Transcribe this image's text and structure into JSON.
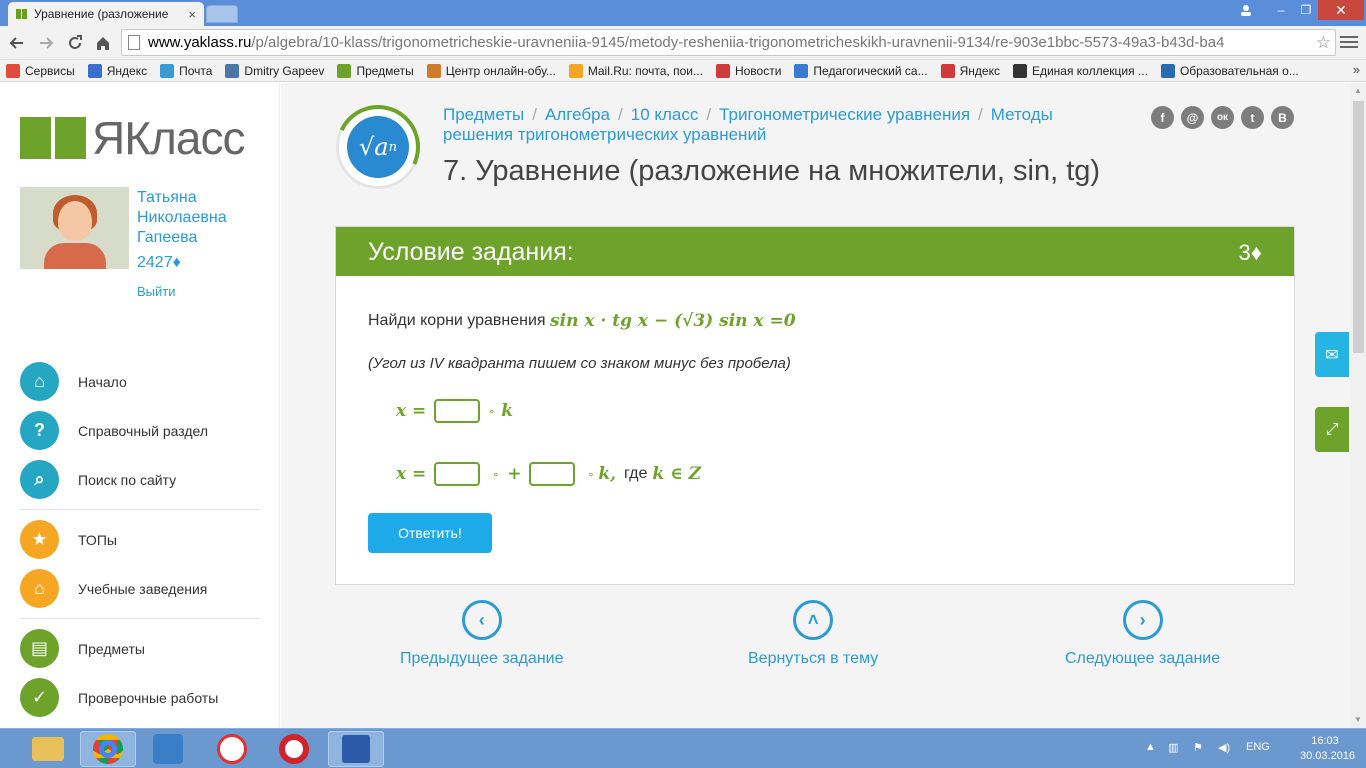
{
  "browser": {
    "tab_title": "Уравнение (разложение",
    "tab_close": "×",
    "url_host": "www.yaklass.ru",
    "url_path": "/p/algebra/10-klass/trigonometricheskie-uravneniia-9145/metody-resheniia-trigonometricheskikh-uravnenii-9134/re-903e1bbc-5573-49a3-b43d-ba4",
    "win_min": "–",
    "win_max": "❐",
    "win_close": "✕"
  },
  "bookmarks": [
    {
      "label": "Сервисы",
      "color": "#e04b3a"
    },
    {
      "label": "Яндекс",
      "color": "#3a6fd0"
    },
    {
      "label": "Почта",
      "color": "#3a9ad0"
    },
    {
      "label": "Dmitry Gapeev",
      "color": "#4a76a8"
    },
    {
      "label": "Предметы",
      "color": "#6ea32b"
    },
    {
      "label": "Центр онлайн-обу...",
      "color": "#d07a2a"
    },
    {
      "label": "Mail.Ru: почта, пои...",
      "color": "#f5a623"
    },
    {
      "label": "Новости",
      "color": "#d03a3a"
    },
    {
      "label": "Педагогический са...",
      "color": "#3a7ad0"
    },
    {
      "label": "Яндекс",
      "color": "#d03a3a"
    },
    {
      "label": "Единая коллекция ...",
      "color": "#333333"
    },
    {
      "label": "Образовательная о...",
      "color": "#2a6ab0"
    }
  ],
  "bookmarks_more": "»",
  "sidebar": {
    "logo": "ЯКласс",
    "user_name": "Татьяна Николаевна Гапеева",
    "user_points": "2427♦",
    "logout": "Выйти",
    "items": [
      {
        "label": "Начало",
        "icon": "home-icon",
        "glyph": "⌂"
      },
      {
        "label": "Справочный раздел",
        "icon": "help-icon",
        "glyph": "?"
      },
      {
        "label": "Поиск по сайту",
        "icon": "search-icon",
        "glyph": "⌕"
      },
      {
        "label": "ТОПы",
        "icon": "star-icon",
        "glyph": "★"
      },
      {
        "label": "Учебные заведения",
        "icon": "institution-icon",
        "glyph": "⌂"
      },
      {
        "label": "Предметы",
        "icon": "book-icon",
        "glyph": "▤"
      },
      {
        "label": "Проверочные работы",
        "icon": "check-icon",
        "glyph": "✓"
      }
    ]
  },
  "header": {
    "breadcrumb": [
      "Предметы",
      "Алгебра",
      "10 класс",
      "Тригонометрические уравнения",
      "Методы решения тригонометрических уравнений"
    ],
    "breadcrumb_sep": "/",
    "title": "7. Уравнение (разложение на множители, sin, tg)",
    "subject_symbol": "√a",
    "subject_sup": "n",
    "social": [
      {
        "icon": "facebook-icon",
        "glyph": "f"
      },
      {
        "icon": "mailru-icon",
        "glyph": "@"
      },
      {
        "icon": "odnoklassniki-icon",
        "glyph": "ок"
      },
      {
        "icon": "twitter-icon",
        "glyph": "t"
      },
      {
        "icon": "vk-icon",
        "glyph": "В"
      }
    ]
  },
  "task": {
    "heading": "Условие задания:",
    "points": "3♦",
    "question_prefix": "Найди корни уравнения",
    "equation": "sin x · tg x − (√3) sin x =0",
    "hint": "(Угол из IV квадранта пишем со знаком минус без пробела)",
    "row1_lhs": "x =",
    "row1_tail": "k",
    "row2_lhs": "x =",
    "row2_plus": "+",
    "row2_tail": "k,",
    "row2_where": "где",
    "row2_cond": "k ∈ Z",
    "degree": "∘",
    "submit": "Ответить!"
  },
  "nav": {
    "prev": "Предыдущее задание",
    "back": "Вернуться в тему",
    "next": "Следующее задание"
  },
  "taskbar": {
    "lang": "ENG",
    "time": "16:03",
    "date": "30.03.2016"
  },
  "colors": {
    "accent_green": "#6ea32b",
    "link_blue": "#2a9bd6",
    "button_blue": "#1eaae8"
  }
}
